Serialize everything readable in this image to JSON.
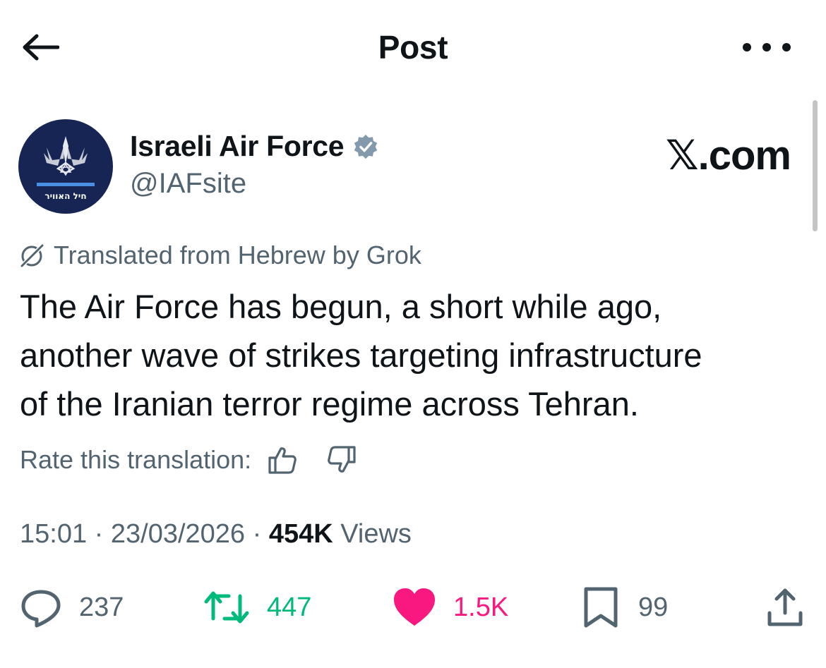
{
  "header": {
    "title": "Post"
  },
  "author": {
    "name": "Israeli Air Force",
    "handle": "@IAFsite",
    "avatar_text": "חיל האוויר",
    "verified": true
  },
  "watermark": "𝕏.com",
  "post": {
    "translation_note": "Translated from Hebrew by Grok",
    "text_lines": [
      "The Air Force has begun, a short while ago,",
      "another wave of strikes targeting infrastructure",
      "of the Iranian terror regime across Tehran."
    ],
    "rate_label": "Rate this translation:",
    "time": "15:01",
    "date": "23/03/2026",
    "views_count": "454K",
    "views_label": "Views"
  },
  "actions": {
    "replies": "237",
    "reposts": "447",
    "likes": "1.5K",
    "bookmarks": "99"
  },
  "colors": {
    "repost": "#00ba7c",
    "like": "#f91880",
    "muted": "#536471",
    "avatar_bg": "#172554",
    "verified_badge": "#829aab"
  },
  "icons": {
    "back": "arrow-left-icon",
    "more": "more-icon",
    "verified": "verified-badge-icon",
    "grok": "grok-icon",
    "thumbs_up": "thumbs-up-icon",
    "thumbs_down": "thumbs-down-icon",
    "reply": "reply-icon",
    "repost": "repost-icon",
    "like": "heart-icon",
    "bookmark": "bookmark-icon",
    "share": "share-icon"
  }
}
